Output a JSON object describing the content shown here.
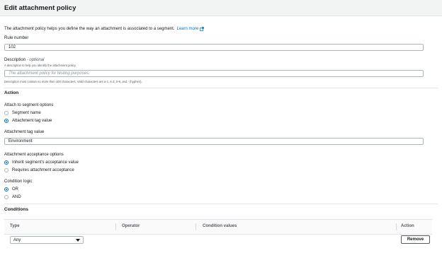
{
  "header": {
    "title": "Edit attachment policy"
  },
  "intro": {
    "text": "The attachment policy helps you define the way an attachment is associated to a segment.",
    "link": "Learn more"
  },
  "rule_number": {
    "label": "Rule number",
    "value": "102"
  },
  "description": {
    "label": "Description",
    "optional": "- optional",
    "help": "A description to help you identify the attachment policy.",
    "placeholder": "The attachment policy for testing purposes.",
    "constraint": "Description must contain no more than 100 characters. Valid characters are a-z, A-Z, 0-9, and - (hyphen)."
  },
  "action": {
    "title": "Action",
    "attach_label": "Attach to segment options",
    "attach_options": [
      "Segment name",
      "Attachment tag value"
    ],
    "attach_selected": "Attachment tag value",
    "tag_label": "Attachment tag value",
    "tag_value": "Environment",
    "acceptance_label": "Attachment acceptance options",
    "acceptance_options": [
      "Inherit segment's acceptance value",
      "Requires attachment acceptance"
    ],
    "acceptance_selected": "Inherit segment's acceptance value",
    "logic_label": "Condition logic",
    "logic_options": [
      "OR",
      "AND"
    ],
    "logic_selected": "OR"
  },
  "conditions": {
    "title": "Conditions",
    "columns": [
      "Type",
      "Operator",
      "Condition values",
      "Action"
    ],
    "row": {
      "type": "Any",
      "remove_label": "Remove"
    }
  },
  "colors": {
    "accent": "#0073bb",
    "header_bg": "#f2f3f3"
  },
  "icons": {
    "external_link": "external-link-icon",
    "caret": "caret-down-icon"
  }
}
